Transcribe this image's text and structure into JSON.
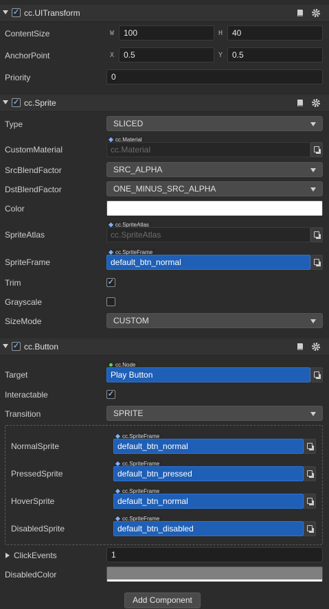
{
  "ui_transform": {
    "title": "cc.UITransform",
    "content_size": {
      "label": "ContentSize",
      "w_axis": "W",
      "w": "100",
      "h_axis": "H",
      "h": "40"
    },
    "anchor_point": {
      "label": "AnchorPoint",
      "x_axis": "X",
      "x": "0.5",
      "y_axis": "Y",
      "y": "0.5"
    },
    "priority": {
      "label": "Priority",
      "value": "0"
    }
  },
  "sprite": {
    "title": "cc.Sprite",
    "type": {
      "label": "Type",
      "value": "SLICED"
    },
    "custom_material": {
      "label": "CustomMaterial",
      "tag": "cc.Material",
      "value": "cc.Material"
    },
    "src_blend": {
      "label": "SrcBlendFactor",
      "value": "SRC_ALPHA"
    },
    "dst_blend": {
      "label": "DstBlendFactor",
      "value": "ONE_MINUS_SRC_ALPHA"
    },
    "color": {
      "label": "Color",
      "value": "#ffffff"
    },
    "sprite_atlas": {
      "label": "SpriteAtlas",
      "tag": "cc.SpriteAtlas",
      "value": "cc.SpriteAtlas"
    },
    "sprite_frame": {
      "label": "SpriteFrame",
      "tag": "cc.SpriteFrame",
      "value": "default_btn_normal"
    },
    "trim": {
      "label": "Trim",
      "checked": true
    },
    "grayscale": {
      "label": "Grayscale",
      "checked": false
    },
    "size_mode": {
      "label": "SizeMode",
      "value": "CUSTOM"
    }
  },
  "button": {
    "title": "cc.Button",
    "target": {
      "label": "Target",
      "tag": "cc.Node",
      "value": "Play Button"
    },
    "interactable": {
      "label": "Interactable",
      "checked": true
    },
    "transition": {
      "label": "Transition",
      "value": "SPRITE"
    },
    "normal_sprite": {
      "label": "NormalSprite",
      "tag": "cc.SpriteFrame",
      "value": "default_btn_normal"
    },
    "pressed_sprite": {
      "label": "PressedSprite",
      "tag": "cc.SpriteFrame",
      "value": "default_btn_pressed"
    },
    "hover_sprite": {
      "label": "HoverSprite",
      "tag": "cc.SpriteFrame",
      "value": "default_btn_normal"
    },
    "disabled_sprite": {
      "label": "DisabledSprite",
      "tag": "cc.SpriteFrame",
      "value": "default_btn_disabled"
    },
    "click_events": {
      "label": "ClickEvents",
      "value": "1"
    },
    "disabled_color": {
      "label": "DisabledColor",
      "value": "#7f7f7f"
    }
  },
  "add_component": {
    "label": "Add Component"
  },
  "icons": {
    "check": "✓",
    "help": "book-icon",
    "settings": "gear-icon"
  },
  "colors": {
    "accent": "#1f5fb6",
    "panel": "#2c2c2c"
  }
}
